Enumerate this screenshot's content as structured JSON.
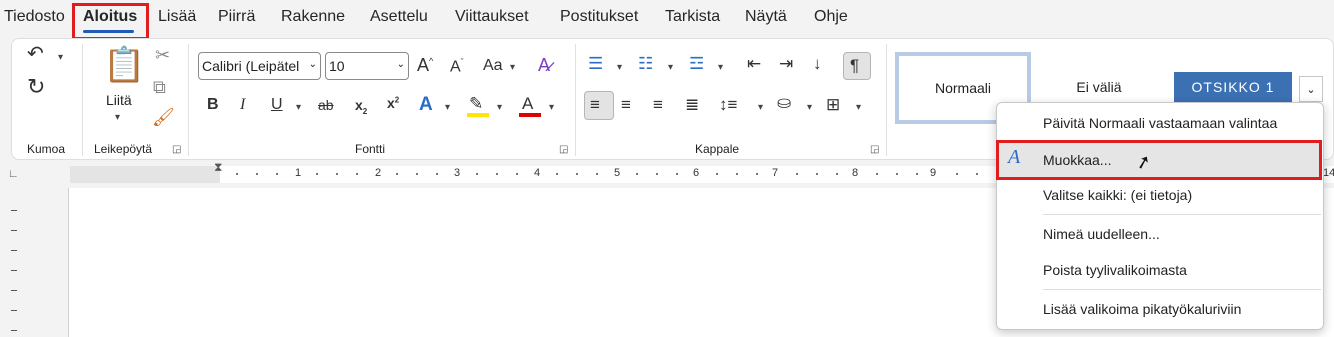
{
  "tabs": [
    "Tiedosto",
    "Aloitus",
    "Lisää",
    "Piirrä",
    "Rakenne",
    "Asettelu",
    "Viittaukset",
    "Postitukset",
    "Tarkista",
    "Näytä",
    "Ohje"
  ],
  "active_tab": "Aloitus",
  "groups": {
    "undo": {
      "label": "Kumoa"
    },
    "clipboard": {
      "label": "Leikepöytä",
      "paste_label": "Liitä"
    },
    "font": {
      "label": "Fontti",
      "font_name": "Calibri (Leipätel",
      "font_size": "10"
    },
    "paragraph": {
      "label": "Kappale"
    }
  },
  "styles": {
    "normal": "Normaali",
    "no_spacing": "Ei väliä",
    "heading1": "OTSIKKO 1"
  },
  "ruler": {
    "numbers": [
      "1",
      "2",
      "3",
      "4",
      "5",
      "6",
      "7",
      "8",
      "9",
      "14"
    ]
  },
  "context_menu": {
    "items": [
      "Päivitä Normaali vastaamaan valintaa",
      "Muokkaa...",
      "Valitse kaikki: (ei tietoja)",
      "Nimeä uudelleen...",
      "Poista tyylivalikoimasta",
      "Lisää valikoima pikatyökaluriviin"
    ]
  },
  "colors": {
    "highlight_box": "#e21d1d",
    "heading1_bg": "#3b71b3",
    "accent": "#1f5bb5",
    "text_highlight": "#ffe600",
    "font_color": "#e00000"
  },
  "icons": [
    "undo-icon",
    "redo-icon",
    "paste-icon",
    "cut-icon",
    "copy-icon",
    "format-painter-icon",
    "grow-font-icon",
    "shrink-font-icon",
    "change-case-icon",
    "clear-format-icon",
    "bold-icon",
    "italic-icon",
    "underline-icon",
    "strikethrough-icon",
    "subscript-icon",
    "superscript-icon",
    "text-effects-icon",
    "highlight-icon",
    "font-color-icon",
    "bullets-icon",
    "numbering-icon",
    "multilevel-list-icon",
    "decrease-indent-icon",
    "increase-indent-icon",
    "sort-icon",
    "show-marks-icon",
    "align-left-icon",
    "align-center-icon",
    "align-right-icon",
    "justify-icon",
    "line-spacing-icon",
    "shading-icon",
    "borders-icon",
    "modify-style-icon"
  ]
}
